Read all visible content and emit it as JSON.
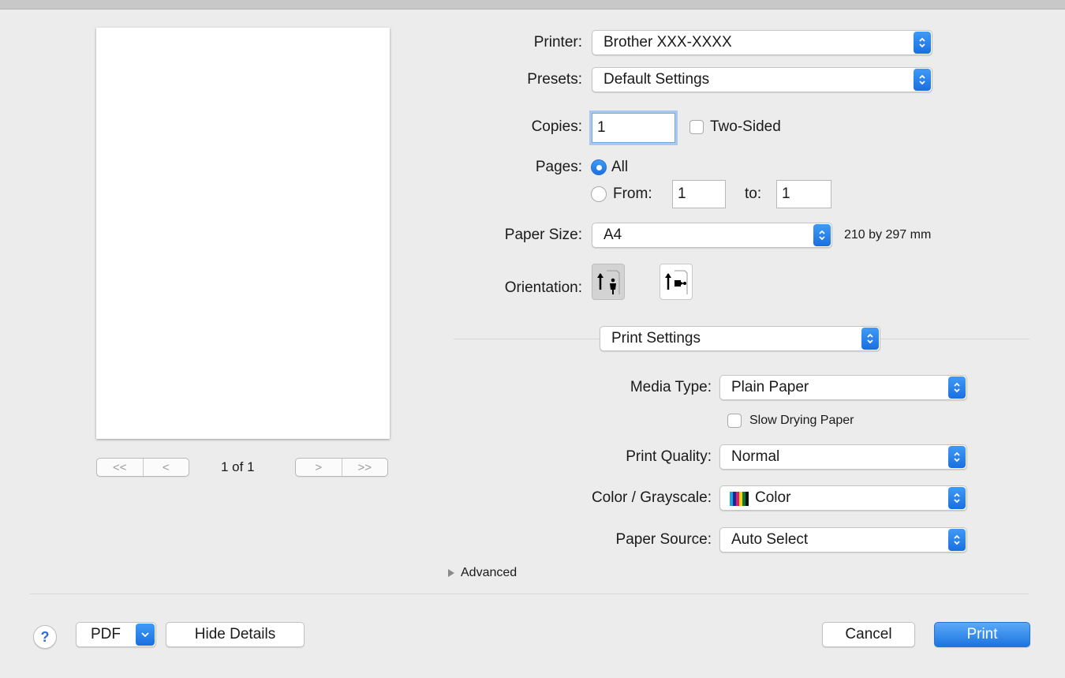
{
  "preview": {
    "page_indicator": "1 of 1",
    "nav": {
      "first": "<<",
      "prev": "<",
      "next": ">",
      "last": ">>"
    }
  },
  "printer": {
    "label": "Printer:",
    "value": "Brother XXX-XXXX"
  },
  "presets": {
    "label": "Presets:",
    "value": "Default Settings"
  },
  "copies": {
    "label": "Copies:",
    "value": "1",
    "two_sided_label": "Two-Sided",
    "two_sided_checked": false
  },
  "pages": {
    "label": "Pages:",
    "all_label": "All",
    "from_label": "From:",
    "from_value": "1",
    "to_label": "to:",
    "to_value": "1",
    "selected": "All"
  },
  "paper_size": {
    "label": "Paper Size:",
    "value": "A4",
    "dimensions": "210 by 297 mm"
  },
  "orientation": {
    "label": "Orientation:",
    "selected": "portrait"
  },
  "section_popup": {
    "value": "Print Settings"
  },
  "media_type": {
    "label": "Media Type:",
    "value": "Plain Paper",
    "slow_drying_label": "Slow Drying Paper",
    "slow_drying_checked": false
  },
  "print_quality": {
    "label": "Print Quality:",
    "value": "Normal"
  },
  "color_grayscale": {
    "label": "Color / Grayscale:",
    "value": "Color"
  },
  "paper_source": {
    "label": "Paper Source:",
    "value": "Auto Select"
  },
  "advanced": {
    "label": "Advanced",
    "expanded": false
  },
  "footer": {
    "help_label": "?",
    "pdf_label": "PDF",
    "hide_details_label": "Hide Details",
    "cancel_label": "Cancel",
    "print_label": "Print"
  },
  "colors": {
    "accent": "#1d74e0",
    "window_bg": "#ececec"
  }
}
